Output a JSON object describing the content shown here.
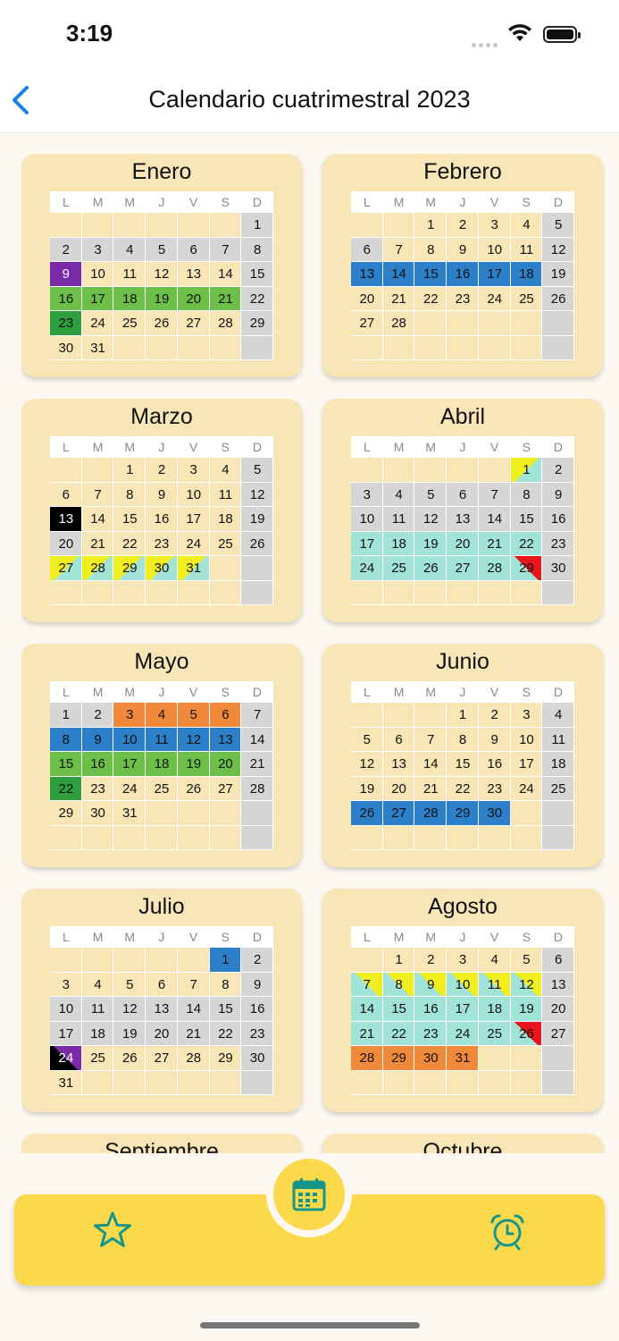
{
  "status": {
    "time": "3:19"
  },
  "nav": {
    "title": "Calendario cuatrimestral 2023"
  },
  "weekdays": [
    "L",
    "M",
    "M",
    "J",
    "V",
    "S",
    "D"
  ],
  "colors": {
    "card": "#f8e6b6",
    "holiday_gray": "#d6d6d6",
    "purple": "#7a2aa8",
    "green": "#6cc04a",
    "dark_green": "#2e9e3f",
    "blue": "#2c7fc9",
    "cyan": "#a2e3d8",
    "orange": "#f08a3a",
    "yellow": "#f1ee1f",
    "red": "#e8161c",
    "tab_yellow": "#fcd94a",
    "icon_teal": "#16968a"
  },
  "months": [
    {
      "name": "Enero",
      "offset": 6,
      "days": 31,
      "marks": {
        "2": "hol",
        "3": "hol",
        "4": "hol",
        "5": "hol",
        "6": "hol",
        "7": "hol",
        "9": "purple",
        "16": "green",
        "17": "green",
        "18": "green",
        "19": "green",
        "20": "green",
        "21": "green",
        "23": "dgreen"
      }
    },
    {
      "name": "Febrero",
      "offset": 2,
      "days": 28,
      "marks": {
        "6": "hol",
        "13": "blue",
        "14": "blue",
        "15": "blue",
        "16": "blue",
        "17": "blue",
        "18": "blue"
      }
    },
    {
      "name": "Marzo",
      "offset": 2,
      "days": 31,
      "marks": {
        "13": "black",
        "20": "hol",
        "27": "cy_y",
        "28": "cy_y",
        "29": "cy_y",
        "30": "cy_y",
        "31": "cy_y"
      }
    },
    {
      "name": "Abril",
      "offset": 5,
      "days": 30,
      "marks": {
        "1": "cy_y",
        "3": "hol",
        "4": "hol",
        "5": "hol",
        "6": "hol",
        "7": "hol",
        "8": "hol",
        "10": "hol",
        "11": "hol",
        "12": "hol",
        "13": "hol",
        "14": "hol",
        "15": "hol",
        "17": "cyan",
        "18": "cyan",
        "19": "cyan",
        "20": "cyan",
        "21": "cyan",
        "22": "cyan",
        "24": "cyan",
        "25": "cyan",
        "26": "cyan",
        "27": "cyan",
        "28": "cyan",
        "29": "cy_r"
      }
    },
    {
      "name": "Mayo",
      "offset": 0,
      "days": 31,
      "marks": {
        "1": "hol",
        "2": "hol",
        "3": "orange",
        "4": "orange",
        "5": "orange",
        "6": "orange",
        "8": "blue",
        "9": "blue",
        "10": "blue",
        "11": "blue",
        "12": "blue",
        "13": "blue",
        "15": "green",
        "16": "green",
        "17": "green",
        "18": "green",
        "19": "green",
        "20": "green",
        "22": "dgreen"
      }
    },
    {
      "name": "Junio",
      "offset": 3,
      "days": 30,
      "marks": {
        "26": "blue",
        "27": "blue",
        "28": "blue",
        "29": "blue",
        "30": "blue"
      }
    },
    {
      "name": "Julio",
      "offset": 5,
      "days": 31,
      "marks": {
        "1": "blue",
        "10": "hol",
        "11": "hol",
        "12": "hol",
        "13": "hol",
        "14": "hol",
        "15": "hol",
        "17": "hol",
        "18": "hol",
        "19": "hol",
        "20": "hol",
        "21": "hol",
        "22": "hol",
        "24": "bk_pu"
      }
    },
    {
      "name": "Agosto",
      "offset": 1,
      "days": 31,
      "marks": {
        "7": "cyan_yr",
        "8": "cyan_yr",
        "9": "cyan_yr",
        "10": "cyan_yr",
        "11": "cyan_yr",
        "12": "cyan_yr",
        "14": "cyan",
        "15": "cyan",
        "16": "cyan",
        "17": "cyan",
        "18": "cyan",
        "19": "cyan",
        "21": "cyan",
        "22": "cyan",
        "23": "cyan",
        "24": "cyan",
        "25": "cyan",
        "26": "cy_r",
        "28": "orange",
        "29": "orange",
        "30": "orange",
        "31": "orange"
      }
    },
    {
      "name": "Septiembre",
      "offset": 4,
      "days": 30,
      "marks": {}
    },
    {
      "name": "Octubre",
      "offset": 6,
      "days": 31,
      "marks": {}
    }
  ],
  "tabs": [
    {
      "name": "favorites",
      "icon": "star-icon"
    },
    {
      "name": "calendar",
      "icon": "calendar-icon"
    },
    {
      "name": "alarms",
      "icon": "alarm-clock-icon"
    }
  ]
}
